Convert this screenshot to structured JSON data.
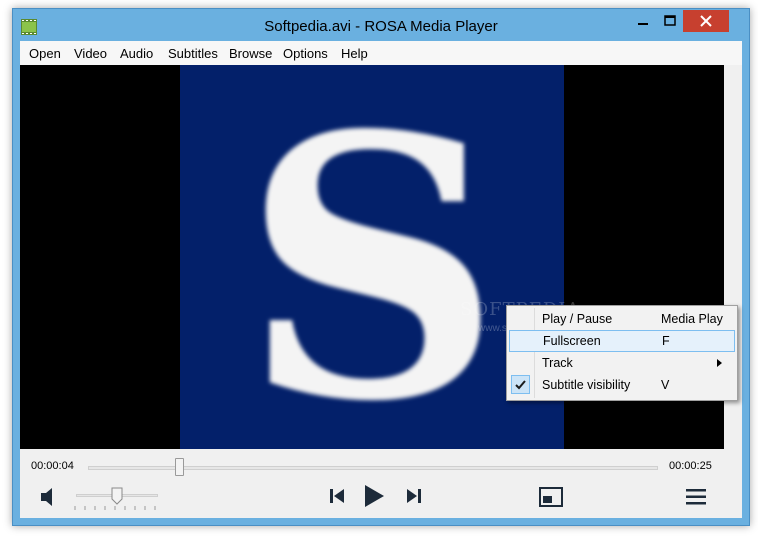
{
  "window": {
    "title": "Softpedia.avi - ROSA Media Player"
  },
  "menubar": {
    "items": [
      "Open",
      "Video",
      "Audio",
      "Subtitles",
      "Browse",
      "Options",
      "Help"
    ]
  },
  "video": {
    "watermark": "SOFTPEDIA",
    "watermark_url": "www.softpedia.com"
  },
  "context_menu": {
    "items": [
      {
        "label": "Play / Pause",
        "shortcut": "Media Play",
        "highlighted": false,
        "checked": false,
        "submenu": false
      },
      {
        "label": "Fullscreen",
        "shortcut": "F",
        "highlighted": true,
        "checked": false,
        "submenu": false
      },
      {
        "label": "Track",
        "shortcut": "",
        "highlighted": false,
        "checked": false,
        "submenu": true
      },
      {
        "label": "Subtitle visibility",
        "shortcut": "V",
        "highlighted": false,
        "checked": true,
        "submenu": false
      }
    ]
  },
  "controls": {
    "elapsed": "00:00:04",
    "total": "00:00:25",
    "seek_fraction": 0.16,
    "volume_fraction": 0.5
  },
  "colors": {
    "video_frame": "#03206a",
    "menu_highlight": "#e5f1fb",
    "close_button": "#c7402f"
  }
}
